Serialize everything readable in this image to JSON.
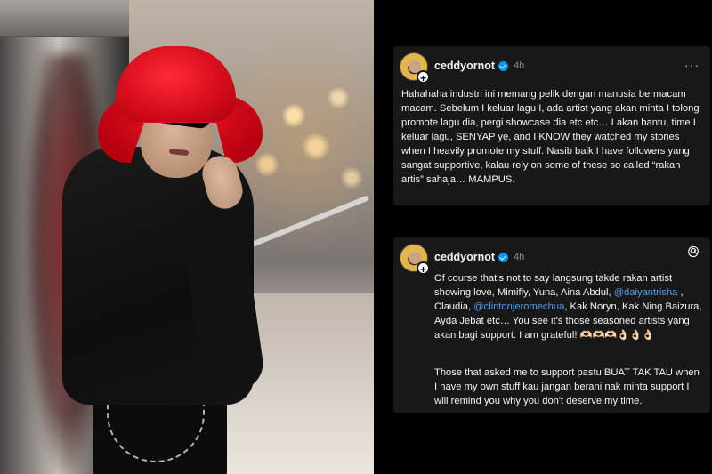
{
  "post1": {
    "username": "ceddyornot",
    "timestamp": "4h",
    "more": "···",
    "text": "Hahahaha industri ini memang pelik dengan manusia bermacam macam. Sebelum I keluar lagu I, ada artist yang akan minta I tolong promote lagu dia, pergi showcase dia etc etc… I akan bantu, time I keluar lagu, SENYAP ye, and I KNOW they watched my stories when I heavily promote my stuff. Nasib baik I have followers yang sangat supportive, kalau rely on some of these so called “rakan artis” sahaja… MAMPUS."
  },
  "post2": {
    "username": "ceddyornot",
    "timestamp": "4h",
    "text_a": "Of course that's not to say langsung takde rakan artist showing love, Mimifly, Yuna, Aina Abdul, ",
    "mention_1": "@daiyantrisha",
    "text_b": " , Claudia, ",
    "mention_2": "@clintonjeromechua",
    "text_c": ", Kak Noryn, Kak Ning Baizura, Ayda Jebat etc… You see it's those seasoned artists yang akan bagi support. I am grateful! 🫶🏻🫶🏻🫶🏻👌🏻👌🏻👌🏻",
    "paragraph2": "Those that asked me to support pastu BUAT TAK TAU when I have my own stuff kau jangan berani nak minta support I will remind you why you don't deserve my time."
  },
  "colors": {
    "card_bg": "#181818",
    "mention": "#4a9ff5",
    "verified": "#0095f6"
  },
  "icons": [
    "avatar",
    "plus-icon",
    "verified-icon",
    "more-icon",
    "threads-logo-icon"
  ]
}
